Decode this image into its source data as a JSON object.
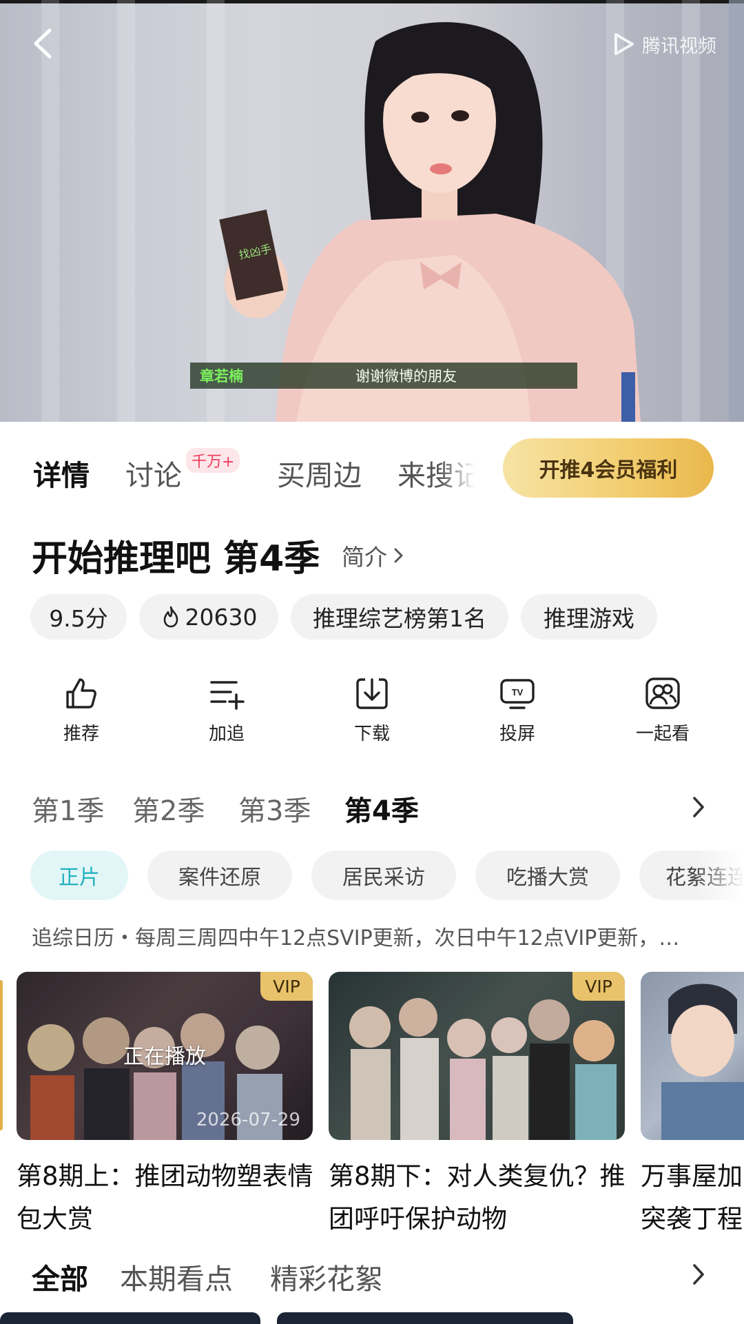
{
  "player": {
    "brand": "腾讯视频",
    "subtitle_name": "章若楠",
    "subtitle_text": "谢谢微博的朋友",
    "card_prop_text": "找凶手"
  },
  "tabs": {
    "items": [
      "详情",
      "讨论",
      "买周边",
      "来搜记"
    ],
    "discuss_badge": "千万+",
    "vip_button": "开推4会员福利"
  },
  "show": {
    "title": "开始推理吧 第4季",
    "intro_link": "简介"
  },
  "chips": {
    "score": "9.5分",
    "heat": "20630",
    "rank": "推理综艺榜第1名",
    "genre": "推理游戏"
  },
  "actions": [
    "推荐",
    "加追",
    "下载",
    "投屏",
    "一起看"
  ],
  "seasons": [
    "第1季",
    "第2季",
    "第3季",
    "第4季"
  ],
  "categories": [
    "正片",
    "案件还原",
    "居民采访",
    "吃播大赏",
    "花絮连连"
  ],
  "calendar_text": "追综日历・每周三周四中午12点SVIP更新，次日中午12点VIP更新，…",
  "episodes": [
    {
      "title": "第8期上：推团动物塑表情包大赏",
      "badge": "VIP",
      "status": "正在播放",
      "date": "2026-07-29"
    },
    {
      "title": "第8期下：对人类复仇？推团呼吁保护动物",
      "badge": "VIP"
    },
    {
      "title": "万事屋加突袭丁程"
    }
  ],
  "bottom_tabs": [
    "全部",
    "本期看点",
    "精彩花絮"
  ],
  "colors": {
    "accent_teal": "#22b2c0",
    "vip_gold": "#f2cd6e",
    "badge_red": "#ee3b5a",
    "subtitle_green": "#7bf05c"
  }
}
